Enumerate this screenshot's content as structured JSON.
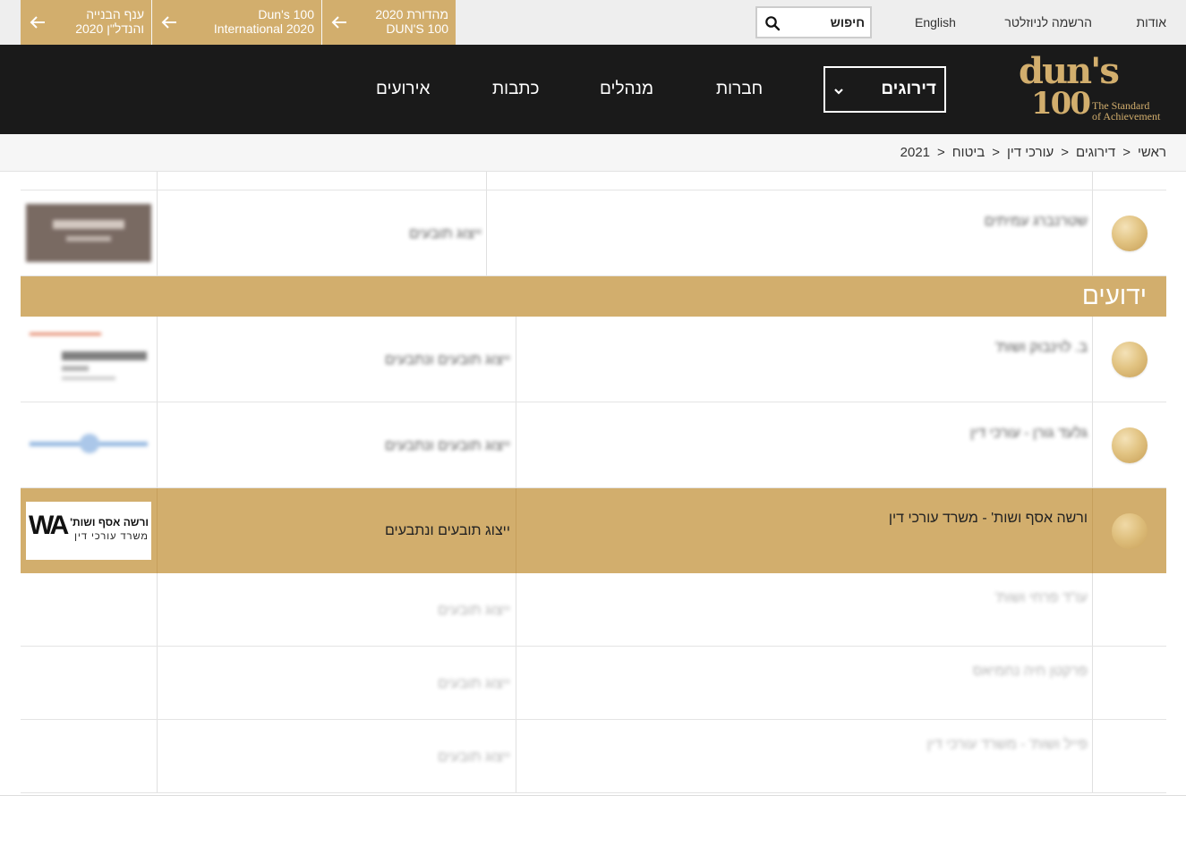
{
  "topbar": {
    "links": [
      "אודות",
      "הרשמה לניוזלטר",
      "English"
    ],
    "search_placeholder": "חיפוש",
    "promos": [
      {
        "line1": "מהדורת 2020",
        "line2": "DUN'S 100"
      },
      {
        "line1": "Dun's 100",
        "line2": "International 2020"
      },
      {
        "line1": "ענף הבנייה",
        "line2": "והנדל\"ן 2020"
      }
    ],
    "colors": {
      "background": "#eeeeee",
      "promo": "#d2ae6d"
    }
  },
  "mainnav": {
    "logo": {
      "mark_line1": "dun's",
      "mark_line2": "100",
      "tagline_line1": "The Standard",
      "tagline_line2": "of Achievement"
    },
    "dropdown_label": "דירוגים",
    "items": [
      "חברות",
      "מנהלים",
      "כתבות",
      "אירועים"
    ],
    "colors": {
      "background": "#1a1a1a",
      "gold": "#d2ae6d"
    }
  },
  "breadcrumb": [
    "ראשי",
    "דירוגים",
    "עורכי דין",
    "ביטוח",
    "2021"
  ],
  "table": {
    "section_title": "ידועים",
    "rows": [
      {
        "firm": "שטרנברג עמיתים",
        "specialty": "ייצוג תובעים",
        "blurred": true,
        "logo": "logo-tile-dark"
      },
      {
        "firm": "ב. לוינבוק ושות'",
        "specialty": "ייצוג תובעים ונתבעים",
        "blurred": true,
        "logo": "logo-levinbook"
      },
      {
        "firm": "גלעד גורן - עורכי דין",
        "specialty": "ייצוג תובעים ונתבעים",
        "blurred": true,
        "logo": "logo-blue-wordmark"
      },
      {
        "firm": "ורשה אסף ושות' - משרד עורכי דין",
        "specialty": "ייצוג תובעים ונתבעים",
        "blurred": false,
        "highlighted": true,
        "logo": "logo-wa"
      },
      {
        "firm": "עו\"ד פרחי ושות'",
        "specialty": "ייצוג תובעים",
        "blurred": true
      },
      {
        "firm": "פרקטן חיה נחמיאס",
        "specialty": "ייצוג תובעים",
        "blurred": true
      },
      {
        "firm": "פייל ושות' - משרד עורכי דין",
        "specialty": "ייצוג תובעים",
        "blurred": true
      }
    ],
    "wa_logo": {
      "mark": "WA",
      "name": "ורשה אסף ושות'",
      "sub": "משרד עורכי דין"
    },
    "colors": {
      "highlight": "#d2ae6d",
      "medal": "#e2c483"
    }
  }
}
